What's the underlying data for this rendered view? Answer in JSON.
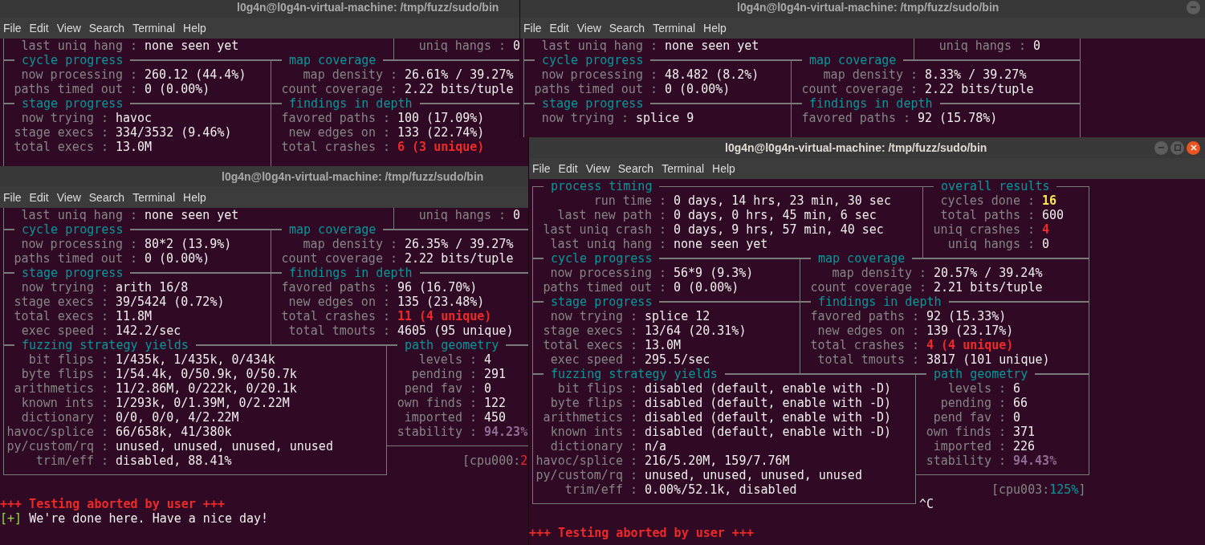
{
  "windows": [
    {
      "title": "l0g4n@l0g4n-virtual-machine: /tmp/fuzz/sudo/bin",
      "focused": false,
      "menu": [
        "File",
        "Edit",
        "View",
        "Search",
        "Terminal",
        "Help"
      ],
      "panels": [
        {
          "kind": "process_timing",
          "rows": [
            {
              "label": "last uniq hang :",
              "value": "none seen yet"
            }
          ]
        },
        {
          "kind": "overall_results",
          "rows": [
            {
              "label": "uniq hangs :",
              "value": "0"
            }
          ]
        },
        {
          "kind": "cycle_progress",
          "title": "cycle progress",
          "rows": [
            {
              "label": "now processing :",
              "value": "260.12 (44.4%)"
            },
            {
              "label": "paths timed out :",
              "value": "0 (0.00%)"
            }
          ]
        },
        {
          "kind": "map_coverage",
          "title": "map coverage",
          "rows": [
            {
              "label": "map density :",
              "value": "26.61% / 39.27%"
            },
            {
              "label": "count coverage :",
              "value": "2.22 bits/tuple"
            }
          ]
        },
        {
          "kind": "stage_progress",
          "title": "stage progress",
          "rows": [
            {
              "label": "now trying :",
              "value": "havoc"
            },
            {
              "label": "stage execs :",
              "value": "334/3532 (9.46%)"
            },
            {
              "label": "total execs :",
              "value": "13.0M"
            }
          ]
        },
        {
          "kind": "findings",
          "title": "findings in depth",
          "rows": [
            {
              "label": "favored paths :",
              "value": "100 (17.09%)"
            },
            {
              "label": "new edges on :",
              "value": "133 (22.74%)"
            },
            {
              "label": "total crashes :",
              "value": "6 (3 unique)",
              "color": "#ef2929"
            }
          ]
        }
      ]
    },
    {
      "title": "l0g4n@l0g4n-virtual-machine: /tmp/fuzz/sudo/bin",
      "focused": false,
      "menu": [
        "File",
        "Edit",
        "View",
        "Search",
        "Terminal",
        "Help"
      ],
      "panels": [
        {
          "kind": "process_timing",
          "rows": [
            {
              "label": "last uniq hang :",
              "value": "none seen yet"
            }
          ]
        },
        {
          "kind": "overall_results",
          "rows": [
            {
              "label": "uniq hangs :",
              "value": "0"
            }
          ]
        },
        {
          "kind": "cycle_progress",
          "title": "cycle progress",
          "rows": [
            {
              "label": "now processing :",
              "value": "80*2 (13.9%)"
            },
            {
              "label": "paths timed out :",
              "value": "0 (0.00%)"
            }
          ]
        },
        {
          "kind": "map_coverage",
          "title": "map coverage",
          "rows": [
            {
              "label": "map density :",
              "value": "26.35% / 39.27%"
            },
            {
              "label": "count coverage :",
              "value": "2.22 bits/tuple"
            }
          ]
        },
        {
          "kind": "stage_progress",
          "title": "stage progress",
          "rows": [
            {
              "label": "now trying :",
              "value": "arith 16/8"
            },
            {
              "label": "stage execs :",
              "value": "39/5424 (0.72%)"
            },
            {
              "label": "total execs :",
              "value": "11.8M"
            },
            {
              "label": "exec speed :",
              "value": "142.2/sec"
            }
          ]
        },
        {
          "kind": "findings",
          "title": "findings in depth",
          "rows": [
            {
              "label": "favored paths :",
              "value": "96 (16.70%)"
            },
            {
              "label": "new edges on :",
              "value": "135 (23.48%)"
            },
            {
              "label": "total crashes :",
              "value": "11 (4 unique)",
              "color": "#ef2929"
            },
            {
              "label": "total tmouts :",
              "value": "4605 (95 unique)"
            }
          ]
        },
        {
          "kind": "strategy_yields",
          "title": "fuzzing strategy yields",
          "rows": [
            {
              "label": "bit flips :",
              "value": "1/435k, 1/435k, 0/434k"
            },
            {
              "label": "byte flips :",
              "value": "1/54.4k, 0/50.9k, 0/50.7k"
            },
            {
              "label": "arithmetics :",
              "value": "11/2.86M, 0/222k, 0/20.1k"
            },
            {
              "label": "known ints :",
              "value": "1/293k, 0/1.39M, 0/2.22M"
            },
            {
              "label": "dictionary :",
              "value": "0/0, 0/0, 4/2.22M"
            },
            {
              "label": "havoc/splice :",
              "value": "66/658k, 41/380k"
            },
            {
              "label": "py/custom/rq :",
              "value": "unused, unused, unused, unused"
            },
            {
              "label": "trim/eff :",
              "value": "disabled, 88.41%"
            }
          ]
        },
        {
          "kind": "path_geometry",
          "title": "path geometry",
          "rows": [
            {
              "label": "levels :",
              "value": "4"
            },
            {
              "label": "pending :",
              "value": "291"
            },
            {
              "label": "pend fav :",
              "value": "0"
            },
            {
              "label": "own finds :",
              "value": "122"
            },
            {
              "label": "imported :",
              "value": "450"
            },
            {
              "label": "stability :",
              "value": "94.23%",
              "color": "#8e6c94"
            }
          ]
        }
      ],
      "cpu": {
        "label": "[cpu000:",
        "value": "2",
        "color": "#ef2929"
      },
      "tail": [
        {
          "kind": "abort",
          "text": "+++ Testing aborted by user +++"
        },
        {
          "kind": "done",
          "mark": "[+]",
          "text": "We're done here. Have a nice day!"
        }
      ]
    },
    {
      "title": "l0g4n@l0g4n-virtual-machine: /tmp/fuzz/sudo/bin",
      "focused": false,
      "menu": [
        "File",
        "Edit",
        "View",
        "Search",
        "Terminal",
        "Help"
      ],
      "panels": [
        {
          "kind": "process_timing",
          "rows": [
            {
              "label": "last uniq hang :",
              "value": "none seen yet"
            }
          ]
        },
        {
          "kind": "overall_results",
          "rows": [
            {
              "label": "uniq hangs :",
              "value": "0"
            }
          ]
        },
        {
          "kind": "cycle_progress",
          "title": "cycle progress",
          "rows": [
            {
              "label": "now processing :",
              "value": "48.482 (8.2%)"
            },
            {
              "label": "paths timed out :",
              "value": "0 (0.00%)"
            }
          ]
        },
        {
          "kind": "map_coverage",
          "title": "map coverage",
          "rows": [
            {
              "label": "map density :",
              "value": "8.33% / 39.27%"
            },
            {
              "label": "count coverage :",
              "value": "2.22 bits/tuple"
            }
          ]
        },
        {
          "kind": "stage_progress",
          "title": "stage progress",
          "rows": [
            {
              "label": "now trying :",
              "value": "splice 9"
            }
          ]
        },
        {
          "kind": "findings",
          "title": "findings in depth",
          "rows": [
            {
              "label": "favored paths :",
              "value": "92 (15.78%)"
            }
          ]
        }
      ]
    },
    {
      "title": "l0g4n@l0g4n-virtual-machine: /tmp/fuzz/sudo/bin",
      "focused": true,
      "menu": [
        "File",
        "Edit",
        "View",
        "Search",
        "Terminal",
        "Help"
      ],
      "panels": [
        {
          "kind": "process_timing",
          "title": "process timing",
          "rows": [
            {
              "label": "run time :",
              "value": "0 days, 14 hrs, 23 min, 30 sec"
            },
            {
              "label": "last new path :",
              "value": "0 days, 0 hrs, 45 min, 6 sec"
            },
            {
              "label": "last uniq crash :",
              "value": "0 days, 9 hrs, 57 min, 40 sec"
            },
            {
              "label": "last uniq hang :",
              "value": "none seen yet"
            }
          ]
        },
        {
          "kind": "overall_results",
          "title": "overall results",
          "rows": [
            {
              "label": "cycles done :",
              "value": "16",
              "color": "#fce94f"
            },
            {
              "label": "total paths :",
              "value": "600"
            },
            {
              "label": "uniq crashes :",
              "value": "4",
              "color": "#ef2929"
            },
            {
              "label": "uniq hangs :",
              "value": "0"
            }
          ]
        },
        {
          "kind": "cycle_progress",
          "title": "cycle progress",
          "rows": [
            {
              "label": "now processing :",
              "value": "56*9 (9.3%)"
            },
            {
              "label": "paths timed out :",
              "value": "0 (0.00%)"
            }
          ]
        },
        {
          "kind": "map_coverage",
          "title": "map coverage",
          "rows": [
            {
              "label": "map density :",
              "value": "20.57% / 39.24%"
            },
            {
              "label": "count coverage :",
              "value": "2.21 bits/tuple"
            }
          ]
        },
        {
          "kind": "stage_progress",
          "title": "stage progress",
          "rows": [
            {
              "label": "now trying :",
              "value": "splice 12"
            },
            {
              "label": "stage execs :",
              "value": "13/64 (20.31%)"
            },
            {
              "label": "total execs :",
              "value": "13.0M"
            },
            {
              "label": "exec speed :",
              "value": "295.5/sec"
            }
          ]
        },
        {
          "kind": "findings",
          "title": "findings in depth",
          "rows": [
            {
              "label": "favored paths :",
              "value": "92 (15.33%)"
            },
            {
              "label": "new edges on :",
              "value": "139 (23.17%)"
            },
            {
              "label": "total crashes :",
              "value": "4 (4 unique)",
              "color": "#ef2929"
            },
            {
              "label": "total tmouts :",
              "value": "3817 (101 unique)"
            }
          ]
        },
        {
          "kind": "strategy_yields",
          "title": "fuzzing strategy yields",
          "rows": [
            {
              "label": "bit flips :",
              "value": "disabled (default, enable with -D)"
            },
            {
              "label": "byte flips :",
              "value": "disabled (default, enable with -D)"
            },
            {
              "label": "arithmetics :",
              "value": "disabled (default, enable with -D)"
            },
            {
              "label": "known ints :",
              "value": "disabled (default, enable with -D)"
            },
            {
              "label": "dictionary :",
              "value": "n/a"
            },
            {
              "label": "havoc/splice :",
              "value": "216/5.20M, 159/7.76M"
            },
            {
              "label": "py/custom/rq :",
              "value": "unused, unused, unused, unused"
            },
            {
              "label": "trim/eff :",
              "value": "0.00%/52.1k, disabled"
            }
          ]
        },
        {
          "kind": "path_geometry",
          "title": "path geometry",
          "rows": [
            {
              "label": "levels :",
              "value": "6"
            },
            {
              "label": "pending :",
              "value": "66"
            },
            {
              "label": "pend fav :",
              "value": "0"
            },
            {
              "label": "own finds :",
              "value": "371"
            },
            {
              "label": "imported :",
              "value": "226"
            },
            {
              "label": "stability :",
              "value": "94.43%",
              "color": "#8e6c94"
            }
          ]
        }
      ],
      "cpu": {
        "label": "[cpu003:",
        "value": "125%",
        "close": "]",
        "color": "#06989a"
      },
      "tail": [
        {
          "kind": "interrupt",
          "text": "^C"
        },
        {
          "kind": "abort",
          "text": "+++ Testing aborted by user +++"
        }
      ]
    }
  ]
}
